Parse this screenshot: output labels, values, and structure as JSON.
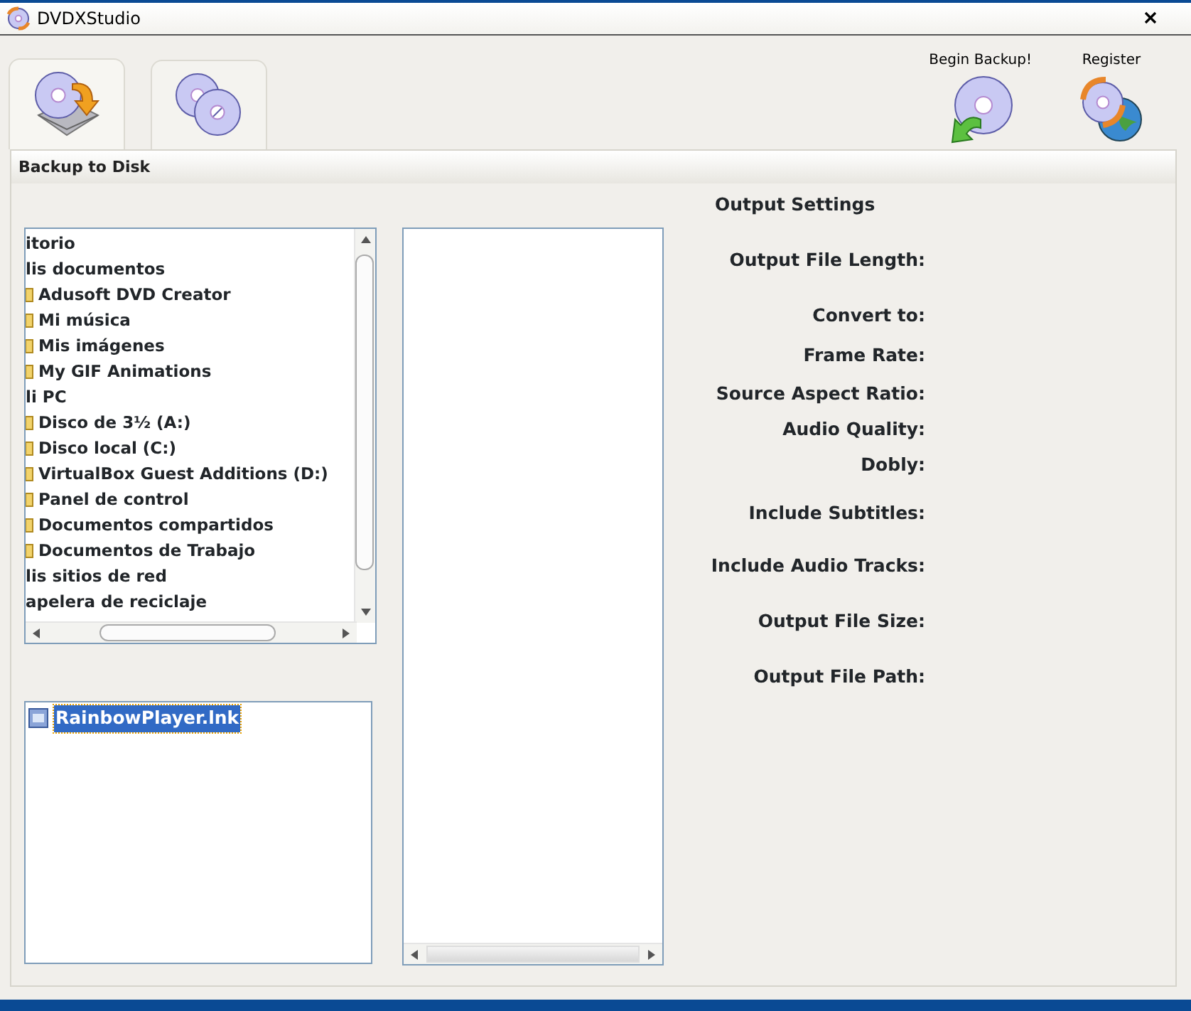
{
  "window": {
    "title": "DVDXStudio"
  },
  "tabs": [
    {
      "selected": true
    },
    {
      "selected": false
    }
  ],
  "toolbar": [
    {
      "label": "Begin Backup!"
    },
    {
      "label": "Register"
    }
  ],
  "section_title": "Backup to Disk",
  "folder_tree": [
    {
      "label": "itorio"
    },
    {
      "label": "lis documentos",
      "children": [
        {
          "label": "Adusoft DVD Creator"
        },
        {
          "label": "Mi música"
        },
        {
          "label": "Mis imágenes"
        },
        {
          "label": "My GIF Animations"
        }
      ]
    },
    {
      "label": "li PC",
      "children": [
        {
          "label": "Disco de 3½ (A:)"
        },
        {
          "label": "Disco local (C:)"
        },
        {
          "label": "VirtualBox Guest Additions (D:)"
        },
        {
          "label": "Panel de control"
        },
        {
          "label": "Documentos compartidos"
        },
        {
          "label": "Documentos de Trabajo"
        }
      ]
    },
    {
      "label": "lis sitios de red"
    },
    {
      "label": "apelera de reciclaje"
    }
  ],
  "files": [
    {
      "label": "RainbowPlayer.lnk",
      "selected": true
    }
  ],
  "output_settings": {
    "title": "Output Settings",
    "fields": [
      "Output File Length:",
      "Convert to:",
      "Frame Rate:",
      "Source Aspect Ratio:",
      "Audio Quality:",
      "Dobly:",
      "Include Subtitles:",
      "Include Audio Tracks:",
      "Output File Size:",
      "Output File Path:"
    ]
  }
}
